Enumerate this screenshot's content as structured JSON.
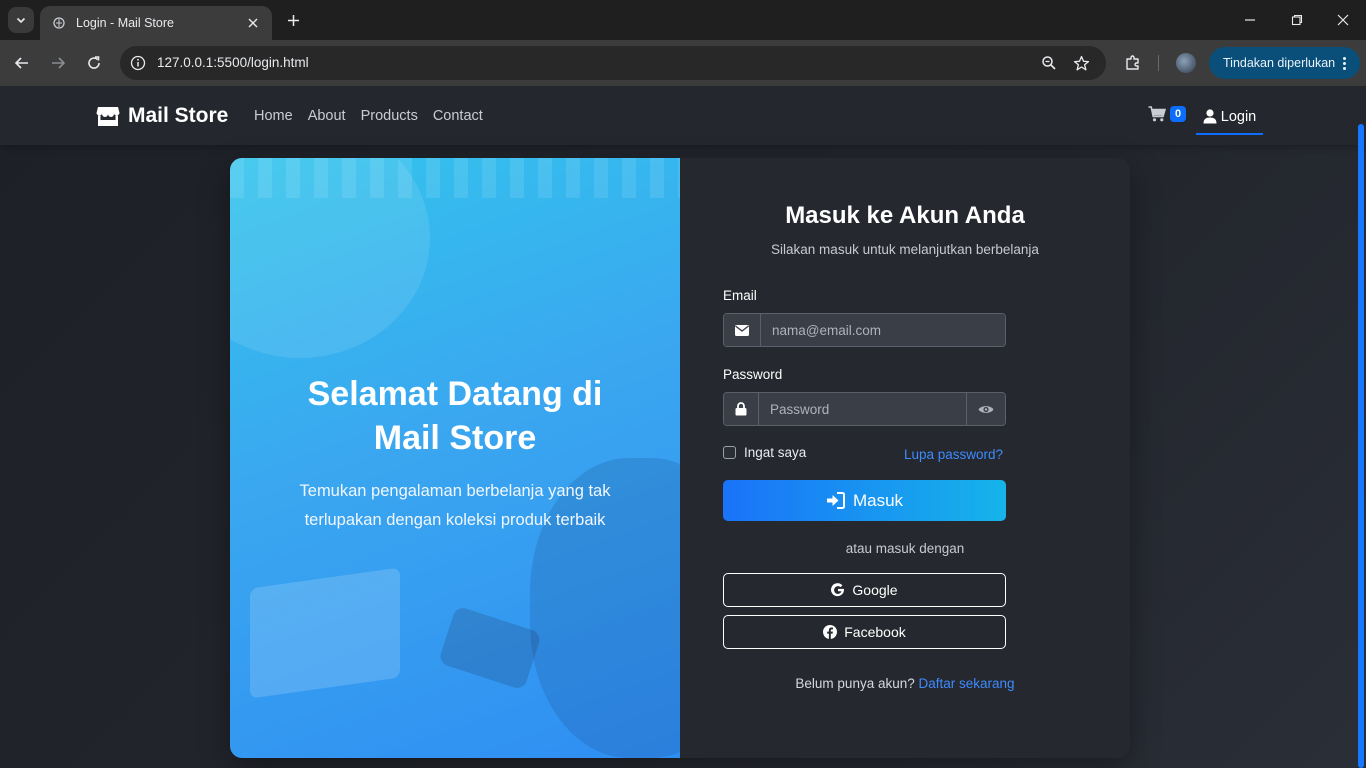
{
  "browser": {
    "tab_title": "Login - Mail Store",
    "url": "127.0.0.1:5500/login.html",
    "action_button": "Tindakan diperlukan"
  },
  "navbar": {
    "brand": "Mail Store",
    "links": [
      "Home",
      "About",
      "Products",
      "Contact"
    ],
    "cart_count": "0",
    "login_label": "Login"
  },
  "hero": {
    "title": "Selamat Datang di Mail Store",
    "subtitle": "Temukan pengalaman berbelanja yang tak terlupakan dengan koleksi produk terbaik"
  },
  "form": {
    "title": "Masuk ke Akun Anda",
    "subtitle": "Silakan masuk untuk melanjutkan berbelanja",
    "email_label": "Email",
    "email_placeholder": "nama@email.com",
    "password_label": "Password",
    "password_placeholder": "Password",
    "remember_label": "Ingat saya",
    "forgot_label": "Lupa password?",
    "submit_label": "Masuk",
    "divider": "atau masuk dengan",
    "google_label": "Google",
    "facebook_label": "Facebook",
    "register_question": "Belum punya akun?",
    "register_link": "Daftar sekarang"
  },
  "colors": {
    "accent": "#0d6efd",
    "link": "#3d8bfd",
    "action_pill": "#0a4f7a"
  }
}
